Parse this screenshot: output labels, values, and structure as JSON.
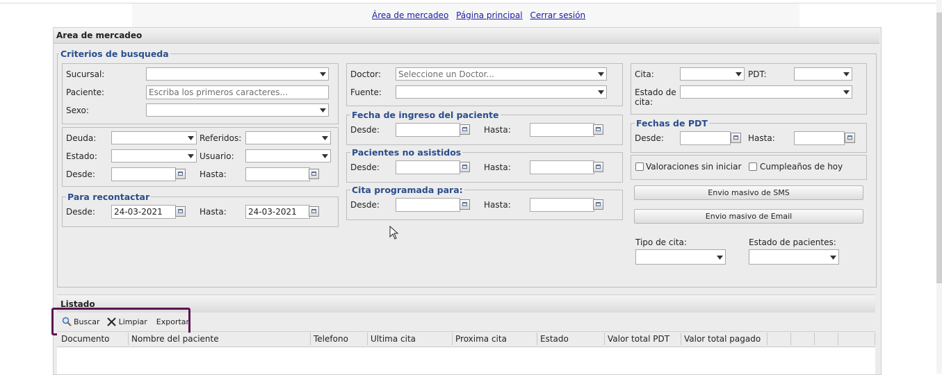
{
  "nav": {
    "links": [
      "Área de mercadeo",
      "Página principal",
      "Cerrar sesión"
    ]
  },
  "panel_title": "Area de mercadeo",
  "criterios": {
    "legend": "Criterios de busqueda",
    "sucursal_label": "Sucursal:",
    "paciente_label": "Paciente:",
    "paciente_placeholder": "Escriba los primeros caracteres...",
    "sexo_label": "Sexo:",
    "deuda_label": "Deuda:",
    "referidos_label": "Referidos:",
    "estado_label": "Estado:",
    "usuario_label": "Usuario:",
    "desde_label": "Desde:",
    "hasta_label": "Hasta:"
  },
  "recontactar": {
    "legend": "Para recontactar",
    "desde_label": "Desde:",
    "desde_value": "24-03-2021",
    "hasta_label": "Hasta:",
    "hasta_value": "24-03-2021"
  },
  "doctor": {
    "doctor_label": "Doctor:",
    "doctor_placeholder": "Seleccione un Doctor...",
    "fuente_label": "Fuente:"
  },
  "ingreso": {
    "legend": "Fecha de ingreso del paciente",
    "desde_label": "Desde:",
    "hasta_label": "Hasta:"
  },
  "no_asistidos": {
    "legend": "Pacientes no asistidos",
    "desde_label": "Desde:",
    "hasta_label": "Hasta:"
  },
  "programada": {
    "legend": "Cita programada para:",
    "desde_label": "Desde:",
    "hasta_label": "Hasta:"
  },
  "cita": {
    "cita_label": "Cita:",
    "pdt_label": "PDT:",
    "estado_cita_label": "Estado de cita:"
  },
  "fechas_pdt": {
    "legend": "Fechas de PDT",
    "desde_label": "Desde:",
    "hasta_label": "Hasta:"
  },
  "checks": {
    "valoraciones": "Valoraciones sin iniciar",
    "cumpleanos": "Cumpleaños de hoy"
  },
  "buttons": {
    "sms": "Envio masivo de SMS",
    "email": "Envio masivo de Email"
  },
  "tipo_cita_label": "Tipo de cita:",
  "estado_pacientes_label": "Estado de pacientes:",
  "listado": {
    "title": "Listado",
    "buscar": "Buscar",
    "limpiar": "Limpiar",
    "exportar": "Exportar",
    "columns": [
      "Documento",
      "Nombre del paciente",
      "Telefono",
      "Ultima cita",
      "Proxima cita",
      "Estado",
      "Valor total PDT",
      "Valor total pagado",
      "",
      "",
      "",
      ""
    ]
  },
  "colors": {
    "legend_blue": "#2b4d8c",
    "link_blue": "#1a1aa6",
    "highlight_purple": "#5a1450"
  },
  "icons": [
    "dropdown-arrow-icon",
    "calendar-icon",
    "search-icon",
    "close-icon",
    "cursor-pointer-icon"
  ]
}
